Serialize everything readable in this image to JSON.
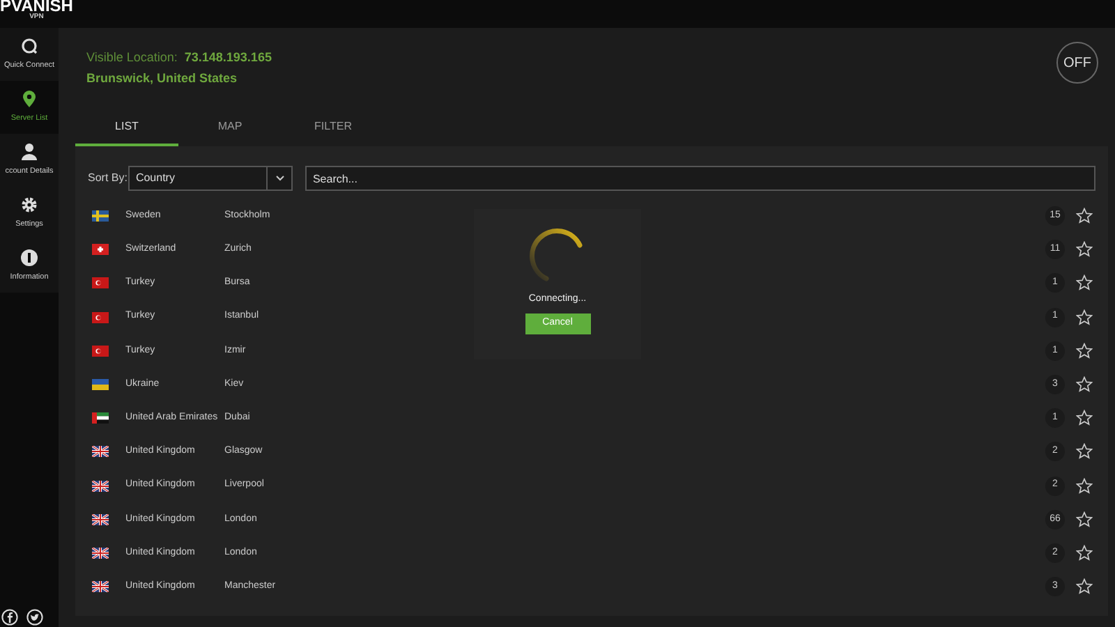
{
  "logo": {
    "name": "PVANISH",
    "sub": "VPN"
  },
  "sidebar": {
    "items": [
      {
        "label": "Quick Connect",
        "selected": false
      },
      {
        "label": "Server List",
        "selected": true
      },
      {
        "label": "ccount Details",
        "selected": false
      },
      {
        "label": "Settings",
        "selected": false
      },
      {
        "label": "Information",
        "selected": false
      }
    ]
  },
  "status": {
    "label": "Visible Location:",
    "ip": "73.148.193.165",
    "place": "Brunswick, United States"
  },
  "power_button": {
    "label": "OFF",
    "on": false
  },
  "tabs": [
    {
      "label": "LIST",
      "selected": true
    },
    {
      "label": "MAP",
      "selected": false
    },
    {
      "label": "FILTER",
      "selected": false
    }
  ],
  "sort": {
    "label": "Sort By:",
    "value": "Country"
  },
  "search": {
    "placeholder": "Search..."
  },
  "servers": [
    {
      "kind": "se",
      "country": "Sweden",
      "city": "Stockholm",
      "count": "15",
      "favorite": false
    },
    {
      "kind": "ch",
      "country": "Switzerland",
      "city": "Zurich",
      "count": "11",
      "favorite": false
    },
    {
      "kind": "tr",
      "country": "Turkey",
      "city": "Bursa",
      "count": "1",
      "favorite": false
    },
    {
      "kind": "tr",
      "country": "Turkey",
      "city": "Istanbul",
      "count": "1",
      "favorite": false
    },
    {
      "kind": "tr",
      "country": "Turkey",
      "city": "Izmir",
      "count": "1",
      "favorite": false
    },
    {
      "kind": "ua",
      "country": "Ukraine",
      "city": "Kiev",
      "count": "3",
      "favorite": false
    },
    {
      "kind": "ae",
      "country": "United Arab Emirates",
      "city": "Dubai",
      "count": "1",
      "favorite": false
    },
    {
      "kind": "gb",
      "country": "United Kingdom",
      "city": "Glasgow",
      "count": "2",
      "favorite": false
    },
    {
      "kind": "gb",
      "country": "United Kingdom",
      "city": "Liverpool",
      "count": "2",
      "favorite": false
    },
    {
      "kind": "gb",
      "country": "United Kingdom",
      "city": "London",
      "count": "66",
      "favorite": false
    },
    {
      "kind": "gb",
      "country": "United Kingdom",
      "city": "London",
      "count": "2",
      "favorite": false
    },
    {
      "kind": "gb",
      "country": "United Kingdom",
      "city": "Manchester",
      "count": "3",
      "favorite": false
    }
  ],
  "dialog": {
    "message": "Connecting...",
    "button": "Cancel"
  }
}
